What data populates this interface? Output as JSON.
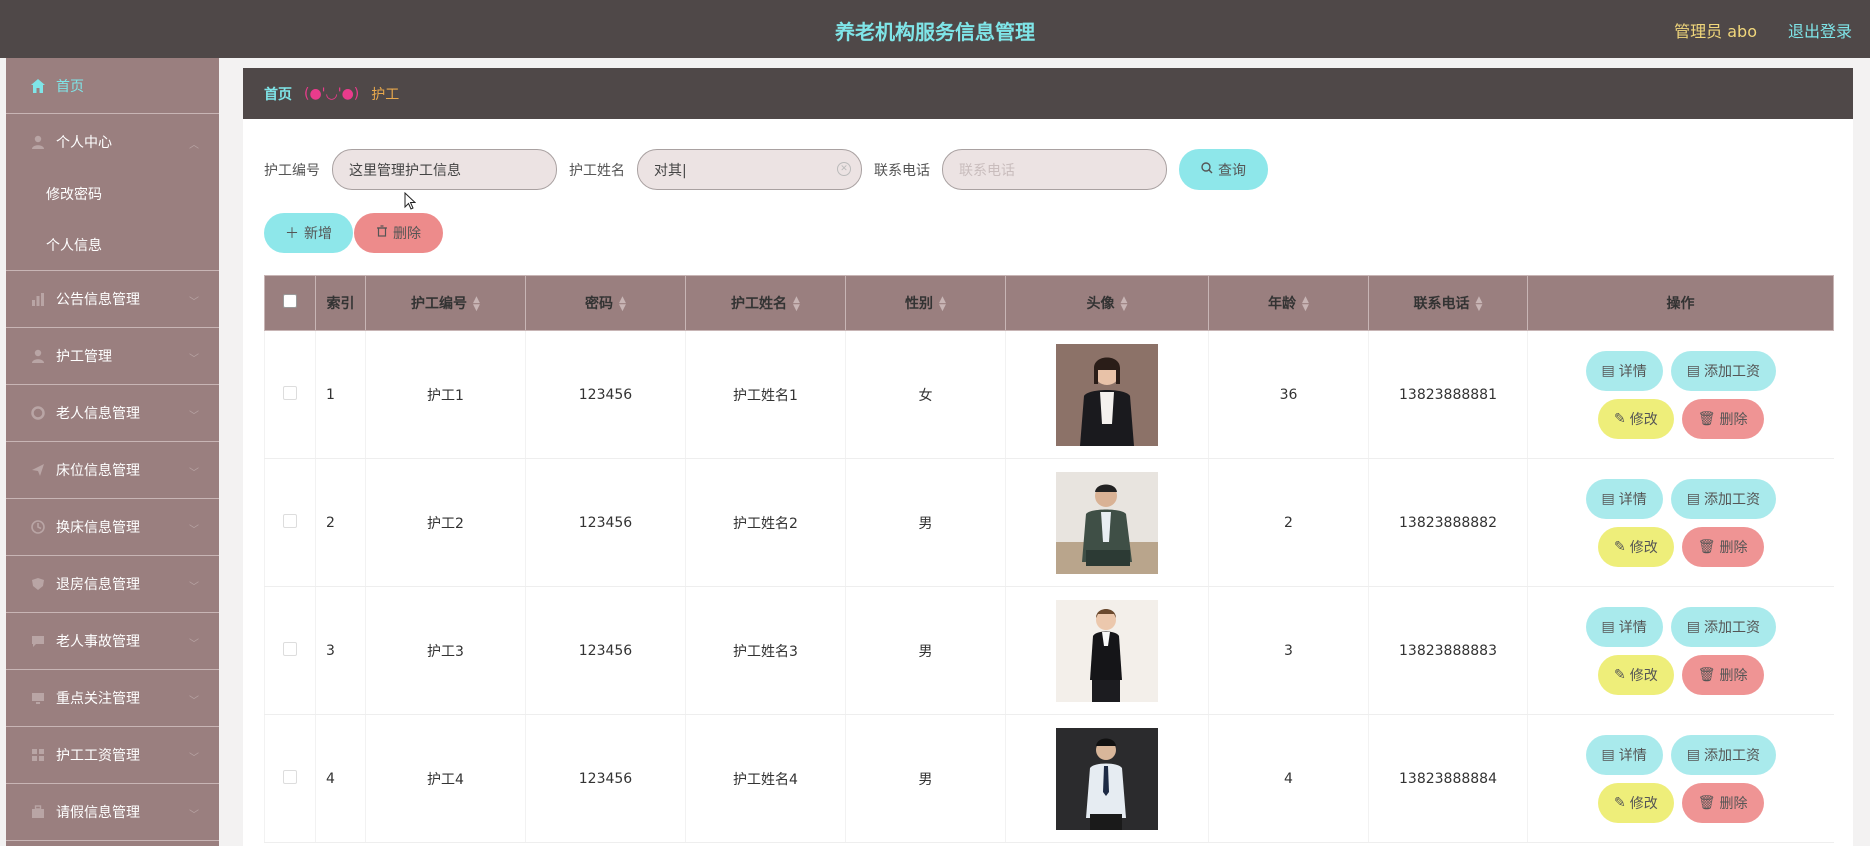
{
  "header": {
    "title": "养老机构服务信息管理",
    "admin": "管理员 abo",
    "logout": "退出登录"
  },
  "sidebar": {
    "home": "首页",
    "personal": {
      "label": "个人中心",
      "subs": [
        "修改密码",
        "个人信息"
      ]
    },
    "items": [
      "公告信息管理",
      "护工管理",
      "老人信息管理",
      "床位信息管理",
      "换床信息管理",
      "退房信息管理",
      "老人事故管理",
      "重点关注管理",
      "护工工资管理",
      "请假信息管理"
    ]
  },
  "breadcrumb": {
    "home": "首页",
    "separator": "(●'◡'●)",
    "current": "护工"
  },
  "search": {
    "id_label": "护工编号",
    "id_value": "这里管理护工信息",
    "name_label": "护工姓名",
    "name_value": "对其|",
    "phone_label": "联系电话",
    "phone_placeholder": "联系电话",
    "query": "查询"
  },
  "actions": {
    "add": "新增",
    "delete": "删除"
  },
  "table": {
    "columns": [
      "索引",
      "护工编号",
      "密码",
      "护工姓名",
      "性别",
      "头像",
      "年龄",
      "联系电话",
      "操作"
    ],
    "rows": [
      {
        "index": "1",
        "id": "护工1",
        "password": "123456",
        "name": "护工姓名1",
        "gender": "女",
        "age": "36",
        "phone": "13823888881"
      },
      {
        "index": "2",
        "id": "护工2",
        "password": "123456",
        "name": "护工姓名2",
        "gender": "男",
        "age": "2",
        "phone": "13823888882"
      },
      {
        "index": "3",
        "id": "护工3",
        "password": "123456",
        "name": "护工姓名3",
        "gender": "男",
        "age": "3",
        "phone": "13823888883"
      },
      {
        "index": "4",
        "id": "护工4",
        "password": "123456",
        "name": "护工姓名4",
        "gender": "男",
        "age": "4",
        "phone": "13823888884"
      }
    ],
    "op": {
      "detail": "详情",
      "salary": "添加工资",
      "edit": "修改",
      "delete": "删除"
    }
  },
  "colors": {
    "header_bg": "#4f4848",
    "sidebar_bg": "#9a7f7f",
    "accent_cyan": "#8ee7ea",
    "accent_red": "#ed8b8b",
    "accent_yellow": "#eeee7a"
  }
}
